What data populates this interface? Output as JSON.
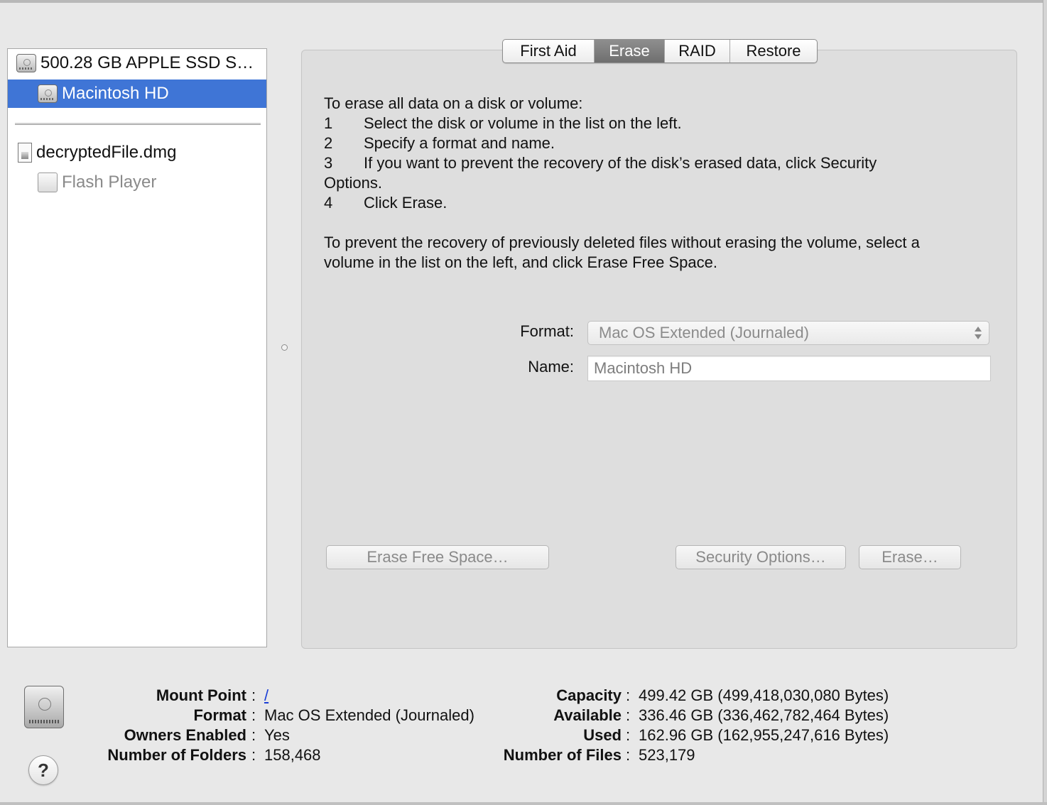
{
  "sidebar": {
    "items": [
      {
        "label": "500.28 GB APPLE SSD S…",
        "icon": "hard-drive-icon"
      },
      {
        "label": "Macintosh HD",
        "icon": "hard-drive-icon",
        "selected": true
      },
      {
        "label": "decryptedFile.dmg",
        "icon": "disk-image-file-icon"
      },
      {
        "label": "Flash Player",
        "icon": "disk-volume-icon",
        "dimmed": true
      }
    ]
  },
  "tabs": [
    {
      "label": "First Aid"
    },
    {
      "label": "Erase",
      "active": true
    },
    {
      "label": "RAID"
    },
    {
      "label": "Restore"
    }
  ],
  "instructions": {
    "intro": "To erase all data on a disk or volume:",
    "steps": [
      {
        "num": "1",
        "text": "Select the disk or volume in the list on the left."
      },
      {
        "num": "2",
        "text": "Specify a format and name."
      },
      {
        "num": "3",
        "text": "If you want to prevent the recovery of the disk’s erased data, click Security"
      },
      {
        "num": "",
        "text": "Options."
      },
      {
        "num": "4",
        "text": "Click Erase."
      }
    ],
    "free_space_line1": "To prevent the recovery of previously deleted files without erasing the volume, select a",
    "free_space_line2": "volume in the list on the left, and click Erase Free Space."
  },
  "form": {
    "format_label": "Format:",
    "format_value": "Mac OS Extended (Journaled)",
    "name_label": "Name:",
    "name_value": "Macintosh HD"
  },
  "buttons": {
    "erase_free_space": "Erase Free Space…",
    "security_options": "Security Options…",
    "erase": "Erase…"
  },
  "info": {
    "mount_point_label": "Mount Point",
    "mount_point_value": "/",
    "format_label": "Format",
    "format_value": "Mac OS Extended (Journaled)",
    "owners_enabled_label": "Owners Enabled",
    "owners_enabled_value": "Yes",
    "folders_label": "Number of Folders",
    "folders_value": "158,468",
    "capacity_label": "Capacity",
    "capacity_value": "499.42 GB (499,418,030,080 Bytes)",
    "available_label": "Available",
    "available_value": "336.46 GB (336,462,782,464 Bytes)",
    "used_label": "Used",
    "used_value": "162.96 GB (162,955,247,616 Bytes)",
    "files_label": "Number of Files",
    "files_value": "523,179",
    "colon": ":"
  },
  "help": {
    "label": "?"
  },
  "colors": {
    "selection": "#3f75d6",
    "active_tab": "#7f7f7f",
    "link": "#1a3fd6"
  }
}
